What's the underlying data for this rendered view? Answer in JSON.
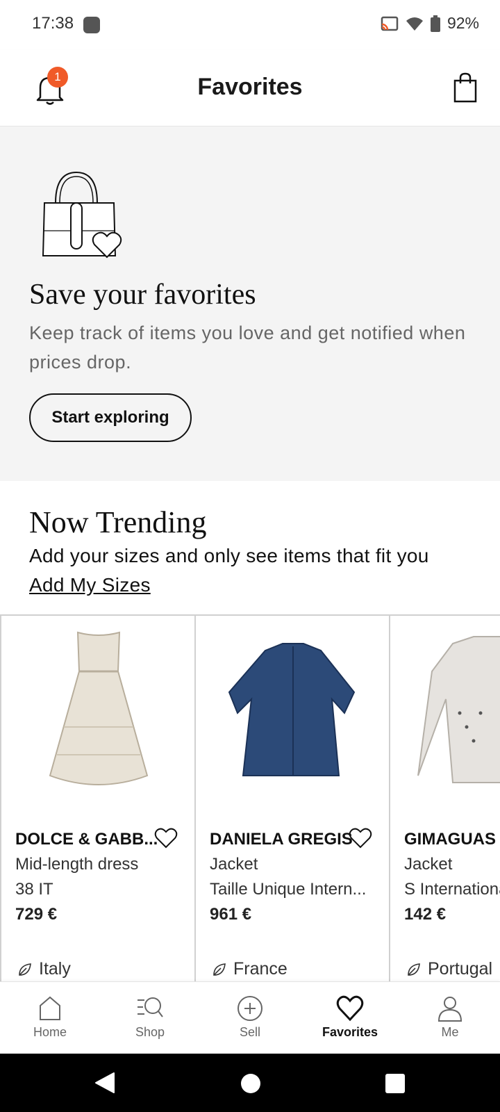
{
  "status_bar": {
    "time": "17:38",
    "battery": "92%"
  },
  "header": {
    "title": "Favorites",
    "notification_count": "1"
  },
  "favorites_empty": {
    "title": "Save your favorites",
    "description": "Keep track of items you love and get notified when prices drop.",
    "button_label": "Start exploring"
  },
  "trending": {
    "title": "Now Trending",
    "subtitle": "Add your sizes and only see items that fit you",
    "link": "Add My Sizes",
    "products": [
      {
        "brand": "DOLCE & GABB...",
        "item": "Mid-length dress",
        "size": "38 IT",
        "price": "729 €",
        "origin": "Italy"
      },
      {
        "brand": "DANIELA GREGIS",
        "item": "Jacket",
        "size": "Taille Unique Intern...",
        "price": "961 €",
        "origin": "France"
      },
      {
        "brand": "GIMAGUAS",
        "item": "Jacket",
        "size": "S International",
        "price": "142 €",
        "origin": "Portugal"
      }
    ]
  },
  "bottom_nav": [
    {
      "label": "Home",
      "icon": "home-icon"
    },
    {
      "label": "Shop",
      "icon": "search-icon"
    },
    {
      "label": "Sell",
      "icon": "plus-circle-icon"
    },
    {
      "label": "Favorites",
      "icon": "heart-icon",
      "active": true
    },
    {
      "label": "Me",
      "icon": "person-icon"
    }
  ],
  "colors": {
    "badge": "#f05a28",
    "section_bg": "#f4f4f4",
    "text": "#111111"
  }
}
